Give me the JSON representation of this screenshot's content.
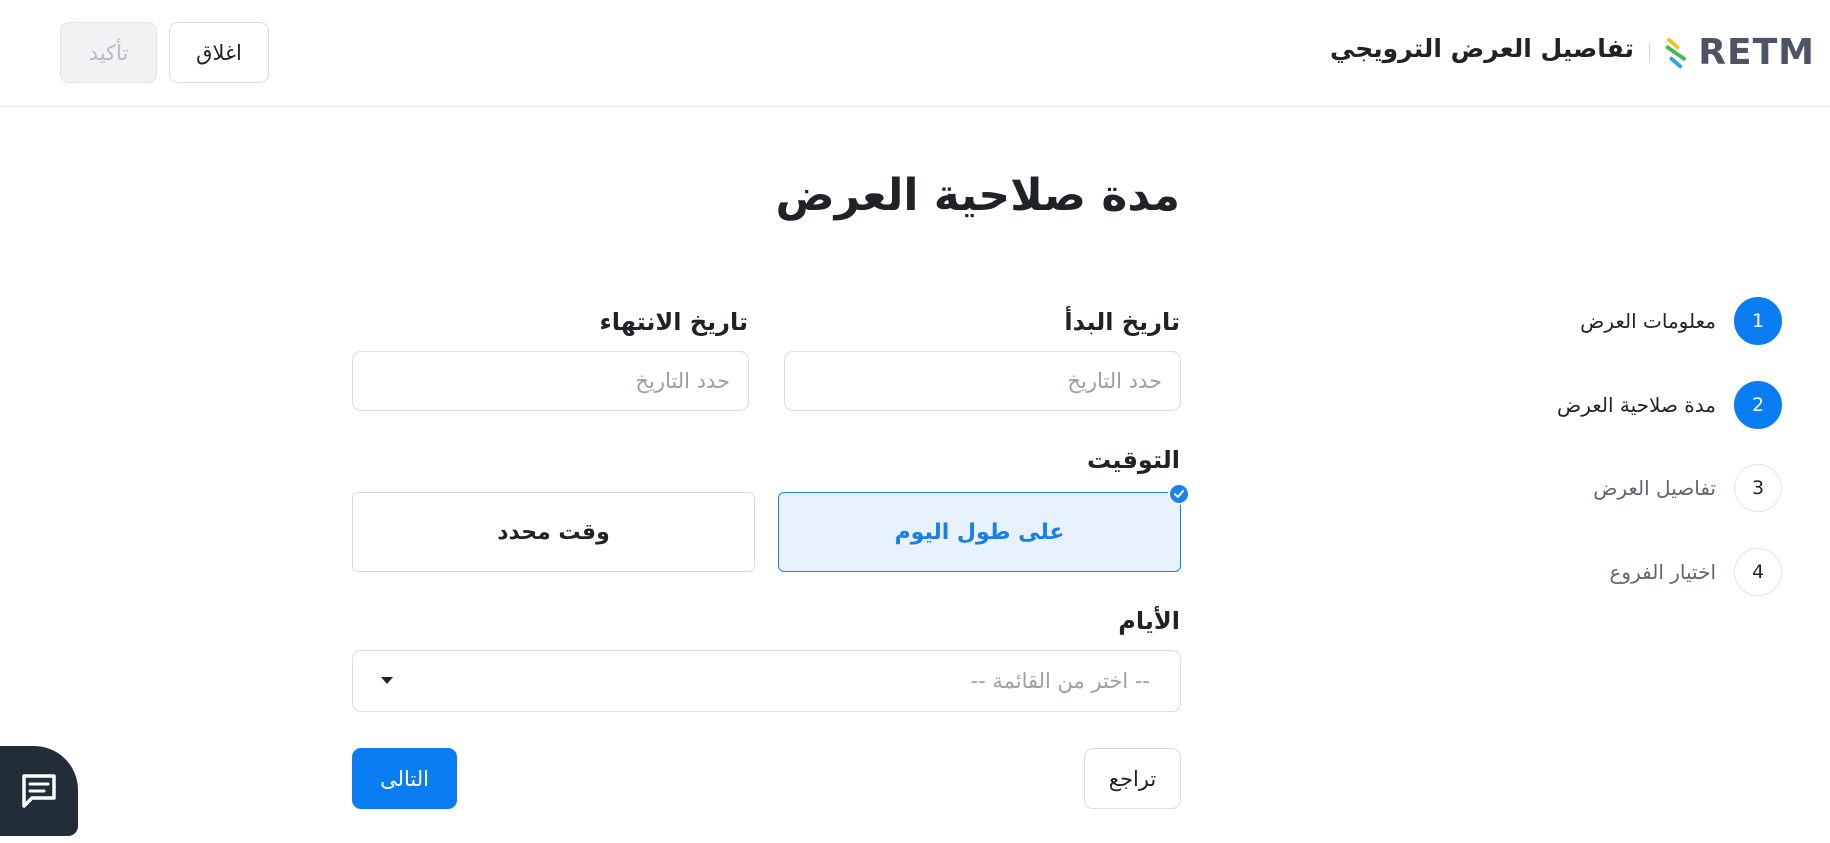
{
  "header": {
    "logo_text": "RETM",
    "title": "تفاصيل العرض الترويجي",
    "close_label": "اغلاق",
    "confirm_label": "تأكيد"
  },
  "page": {
    "title": "مدة صلاحية العرض"
  },
  "form": {
    "start_date": {
      "label": "تاريخ البدأ",
      "placeholder": "حدد التاريخ"
    },
    "end_date": {
      "label": "تاريخ الانتهاء",
      "placeholder": "حدد التاريخ"
    },
    "timing": {
      "label": "التوقيت",
      "options": [
        {
          "label": "على طول اليوم",
          "selected": true
        },
        {
          "label": "وقت محدد",
          "selected": false
        }
      ]
    },
    "days": {
      "label": "الأيام",
      "placeholder": "-- اختر من القائمة --"
    },
    "back_label": "تراجع",
    "next_label": "التالى"
  },
  "stepper": {
    "steps": [
      {
        "number": "1",
        "label": "معلومات العرض",
        "state": "done"
      },
      {
        "number": "2",
        "label": "مدة صلاحية العرض",
        "state": "current"
      },
      {
        "number": "3",
        "label": "تفاصيل العرض",
        "state": "upcoming"
      },
      {
        "number": "4",
        "label": "اختيار الفروع",
        "state": "upcoming"
      }
    ]
  },
  "colors": {
    "primary": "#0a7df2",
    "selected_bg": "#e8f2fe",
    "chat_bg": "#222d3a"
  },
  "icons": {
    "logo": "retm-stripes-logo",
    "check": "check-icon",
    "caret": "caret-down-icon",
    "chat": "chat-icon"
  }
}
